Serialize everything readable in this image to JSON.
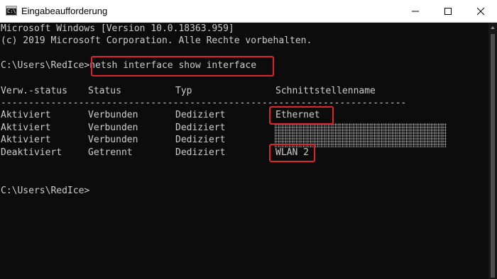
{
  "window": {
    "title": "Eingabeaufforderung",
    "app_icon_glyph": "C:\\"
  },
  "console": {
    "header_line_1": "Microsoft Windows [Version 10.0.18363.959]",
    "header_line_2": "(c) 2019 Microsoft Corporation. Alle Rechte vorbehalten.",
    "prompt_1": "C:\\Users\\RedIce>",
    "command": "netsh interface show interface",
    "columns": [
      "Verw.-status",
      "Status",
      "Typ",
      "Schnittstellenname"
    ],
    "separator": "-------------------------------------------------------------------------",
    "rows": [
      {
        "admin": "Aktiviert",
        "status": "Verbunden",
        "type": "Dediziert",
        "name": "Ethernet"
      },
      {
        "admin": "Aktiviert",
        "status": "Verbunden",
        "type": "Dediziert",
        "name": ""
      },
      {
        "admin": "Aktiviert",
        "status": "Verbunden",
        "type": "Dediziert",
        "name": ""
      },
      {
        "admin": "Deaktiviert",
        "status": "Getrennt",
        "type": "Dediziert",
        "name": "WLAN 2"
      }
    ],
    "prompt_2": "C:\\Users\\RedIce>"
  },
  "colors": {
    "background": "#0c0c0c",
    "text": "#cccccc",
    "highlight_border": "#e0242e",
    "titlebar": "#ffffff"
  },
  "icons": {
    "app": "cmd-icon",
    "minimize": "minimize-icon",
    "maximize": "maximize-icon",
    "close": "close-icon"
  }
}
